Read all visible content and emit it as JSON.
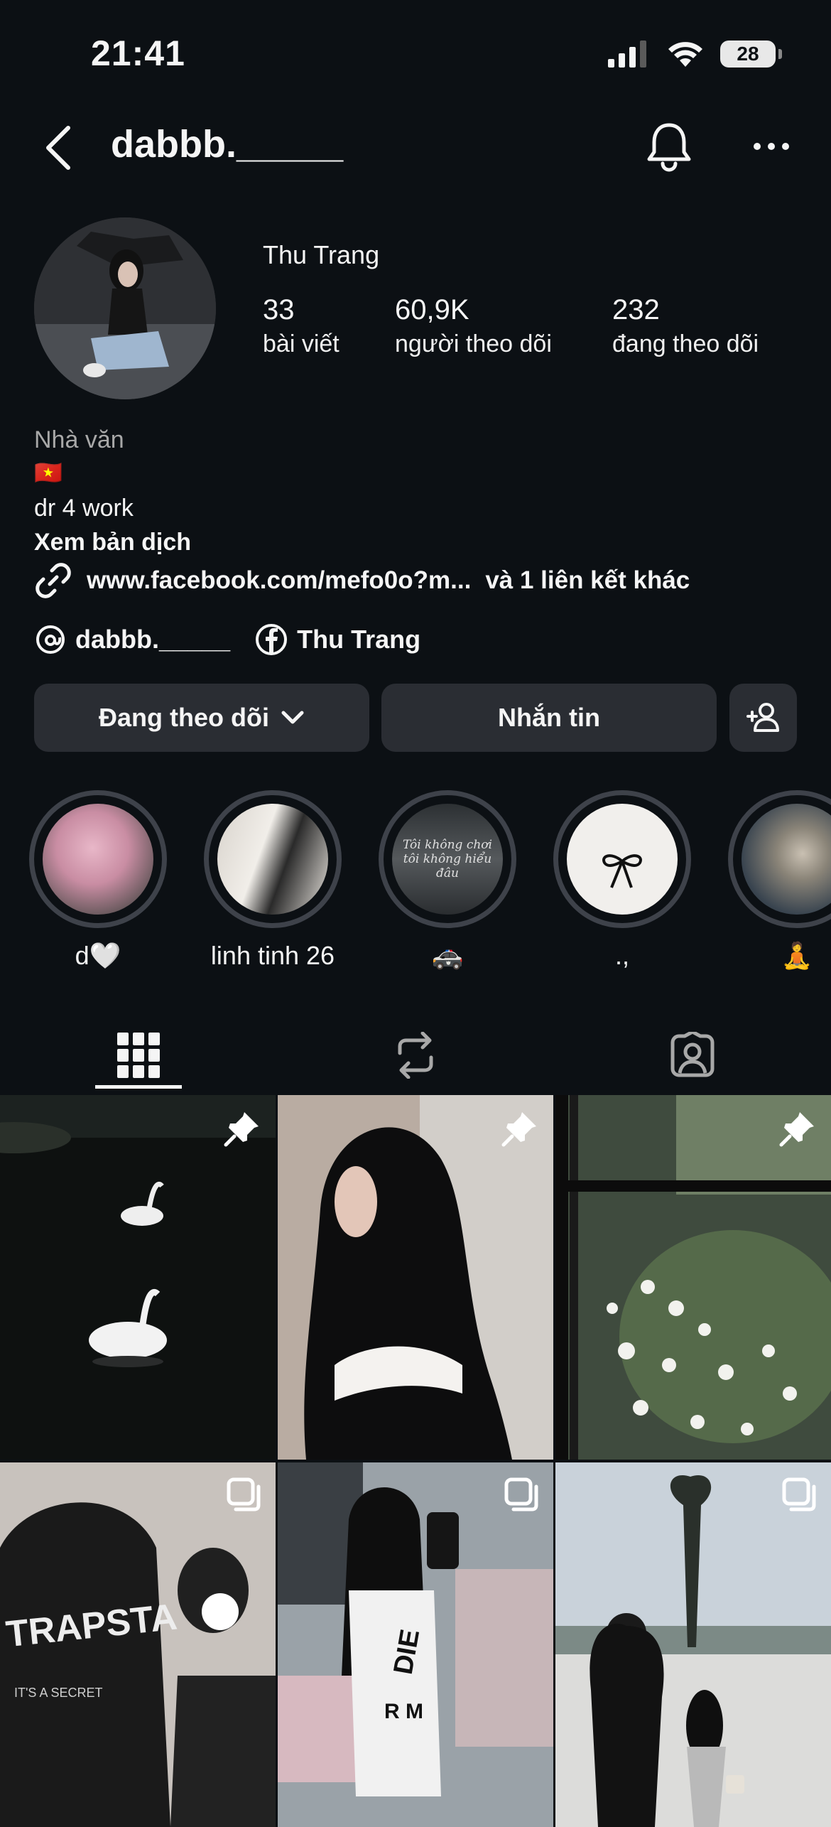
{
  "status_bar": {
    "time": "21:41",
    "battery": "28"
  },
  "header": {
    "username": "dabbb._____"
  },
  "profile": {
    "display_name": "Thu Trang",
    "stats": [
      {
        "value": "33",
        "label": "bài viết"
      },
      {
        "value": "60,9K",
        "label": "người theo dõi"
      },
      {
        "value": "232",
        "label": "đang theo dõi"
      }
    ],
    "category": "Nhà văn",
    "flag": "🇻🇳",
    "bio_line": "dr 4 work",
    "translate_label": "Xem bản dịch",
    "link_text": "www.facebook.com/mefo0o?m...",
    "link_more": "và 1 liên kết khác",
    "threads_handle": "dabbb._____",
    "facebook_name": "Thu Trang"
  },
  "actions": {
    "following_label": "Đang theo dõi",
    "message_label": "Nhắn tin"
  },
  "highlights": [
    {
      "label": "d🤍"
    },
    {
      "label": "linh tinh 26"
    },
    {
      "label": "🚓",
      "cover_text_1": "Tôi không chơi",
      "cover_text_2": "tôi không hiểu đâu"
    },
    {
      "label": ".,"
    },
    {
      "label": "🧘"
    }
  ],
  "grid_overlay_text": {
    "post4_text_1": "TRAPSTA",
    "post4_text_2": "IT'S A SECRET",
    "post5_text_1": "DIE",
    "post5_text_2": "R M"
  },
  "colors": {
    "background": "#0c1014",
    "button": "#2a2d33",
    "text": "#f5f5f5",
    "muted": "#a8a8a8"
  }
}
